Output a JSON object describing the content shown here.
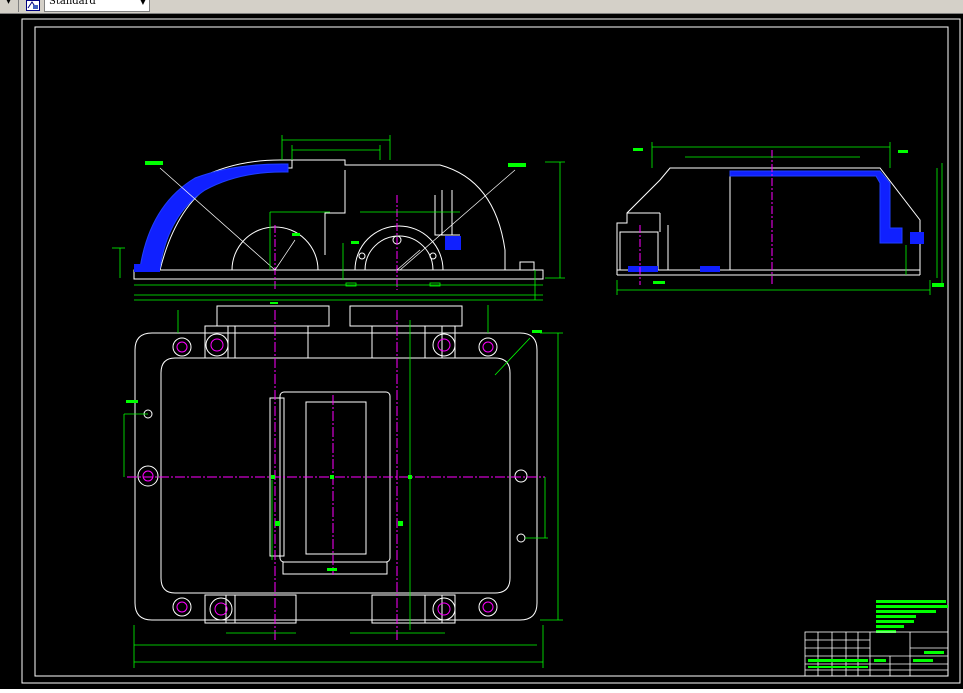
{
  "toolbar": {
    "text_style": "Standard",
    "style_icon": "text-style-icon",
    "dropdown_icon": "chevron-down-icon"
  },
  "colors": {
    "background": "#000000",
    "outline": "#ffffff",
    "dimension": "#00ff00",
    "centerline": "#ff00ff",
    "hatch": "#0000ff"
  }
}
